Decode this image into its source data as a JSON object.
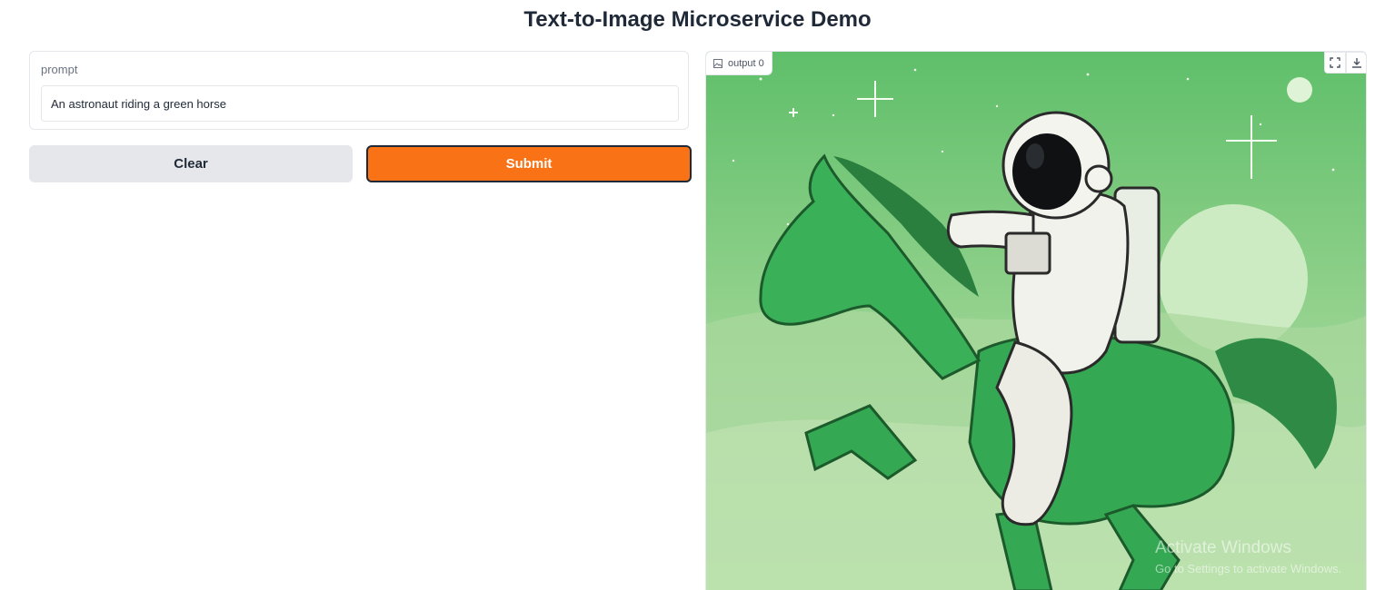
{
  "page": {
    "title": "Text-to-Image Microservice Demo"
  },
  "prompt": {
    "label": "prompt",
    "value": "An astronaut riding a green horse"
  },
  "buttons": {
    "clear": "Clear",
    "submit": "Submit"
  },
  "output": {
    "label": "output 0",
    "fullscreen_icon": "fullscreen-icon",
    "download_icon": "download-icon"
  },
  "watermark": {
    "line1": "Activate Windows",
    "line2": "Go to Settings to activate Windows."
  },
  "colors": {
    "accent": "#f97316",
    "button_secondary": "#e5e7eb",
    "image_bg": "#b9dfae"
  }
}
